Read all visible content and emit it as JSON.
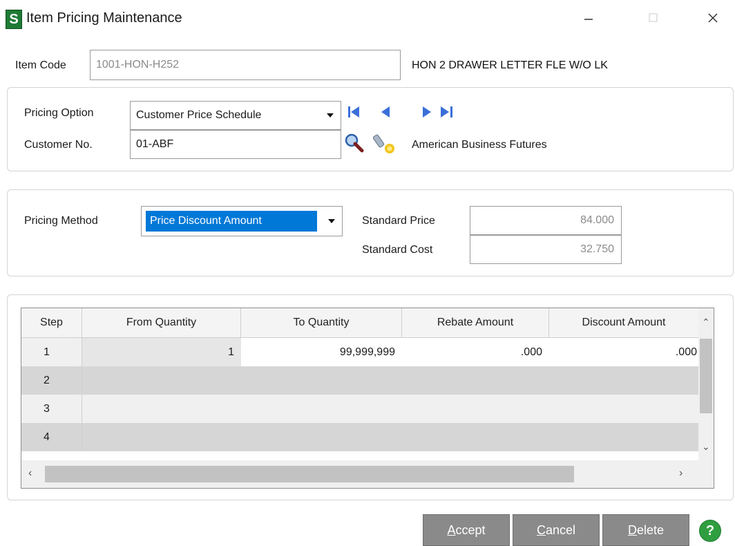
{
  "window": {
    "logo_letter": "S",
    "title": "Item Pricing Maintenance"
  },
  "item": {
    "label": "Item Code",
    "value": "1001-HON-H252",
    "description": "HON 2 DRAWER LETTER FLE W/O LK"
  },
  "pricing_option": {
    "label": "Pricing Option",
    "value": "Customer Price Schedule",
    "customer_label": "Customer No.",
    "customer_value": "01-ABF",
    "customer_name": "American Business Futures"
  },
  "pricing_method": {
    "label": "Pricing Method",
    "value": "Price Discount Amount",
    "standard_price_label": "Standard Price",
    "standard_price": "84.000",
    "standard_cost_label": "Standard Cost",
    "standard_cost": "32.750"
  },
  "grid": {
    "columns": [
      "Step",
      "From Quantity",
      "To Quantity",
      "Rebate Amount",
      "Discount Amount"
    ],
    "rows": [
      {
        "step": "1",
        "from": "1",
        "to": "99,999,999",
        "rebate": ".000",
        "discount": ".000"
      },
      {
        "step": "2",
        "from": "",
        "to": "",
        "rebate": "",
        "discount": ""
      },
      {
        "step": "3",
        "from": "",
        "to": "",
        "rebate": "",
        "discount": ""
      },
      {
        "step": "4",
        "from": "",
        "to": "",
        "rebate": "",
        "discount": ""
      }
    ]
  },
  "buttons": {
    "accept_first": "A",
    "accept_rest": "ccept",
    "cancel_first": "C",
    "cancel_rest": "ancel",
    "delete_first": "D",
    "delete_rest": "elete",
    "help": "?"
  },
  "colors": {
    "selection": "#0078d7",
    "button_bg": "#8a8a8a",
    "help_green": "#2f9e40",
    "nav_blue": "#3a6fd8"
  }
}
